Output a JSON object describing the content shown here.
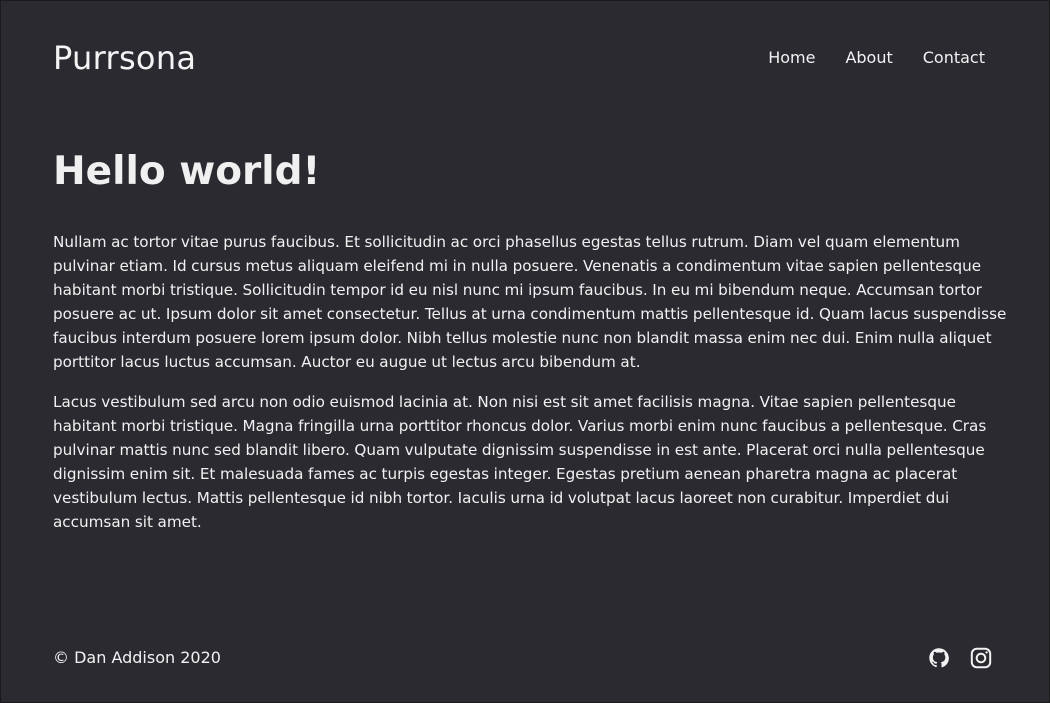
{
  "site": {
    "brand": "Purrsona"
  },
  "nav": {
    "items": [
      "Home",
      "About",
      "Contact"
    ]
  },
  "content": {
    "title": "Hello world!",
    "paragraphs": [
      "Nullam ac tortor vitae purus faucibus. Et sollicitudin ac orci phasellus egestas tellus rutrum. Diam vel quam elementum pulvinar etiam. Id cursus metus aliquam eleifend mi in nulla posuere. Venenatis a condimentum vitae sapien pellentesque habitant morbi tristique. Sollicitudin tempor id eu nisl nunc mi ipsum faucibus. In eu mi bibendum neque. Accumsan tortor posuere ac ut. Ipsum dolor sit amet consectetur. Tellus at urna condimentum mattis pellentesque id. Quam lacus suspendisse faucibus interdum posuere lorem ipsum dolor. Nibh tellus molestie nunc non blandit massa enim nec dui. Enim nulla aliquet porttitor lacus luctus accumsan. Auctor eu augue ut lectus arcu bibendum at.",
      "Lacus vestibulum sed arcu non odio euismod lacinia at. Non nisi est sit amet facilisis magna. Vitae sapien pellentesque habitant morbi tristique. Magna fringilla urna porttitor rhoncus dolor. Varius morbi enim nunc faucibus a pellentesque. Cras pulvinar mattis nunc sed blandit libero. Quam vulputate dignissim suspendisse in est ante. Placerat orci nulla pellentesque dignissim enim sit. Et malesuada fames ac turpis egestas integer. Egestas pretium aenean pharetra magna ac placerat vestibulum lectus. Mattis pellentesque id nibh tortor. Iaculis urna id volutpat lacus laoreet non curabitur. Imperdiet dui accumsan sit amet."
    ]
  },
  "footer": {
    "copyright": "© Dan Addison 2020",
    "icons": [
      "github-icon",
      "instagram-icon"
    ]
  },
  "colors": {
    "background": "#2a2a30",
    "text": "#f2f2f2"
  }
}
